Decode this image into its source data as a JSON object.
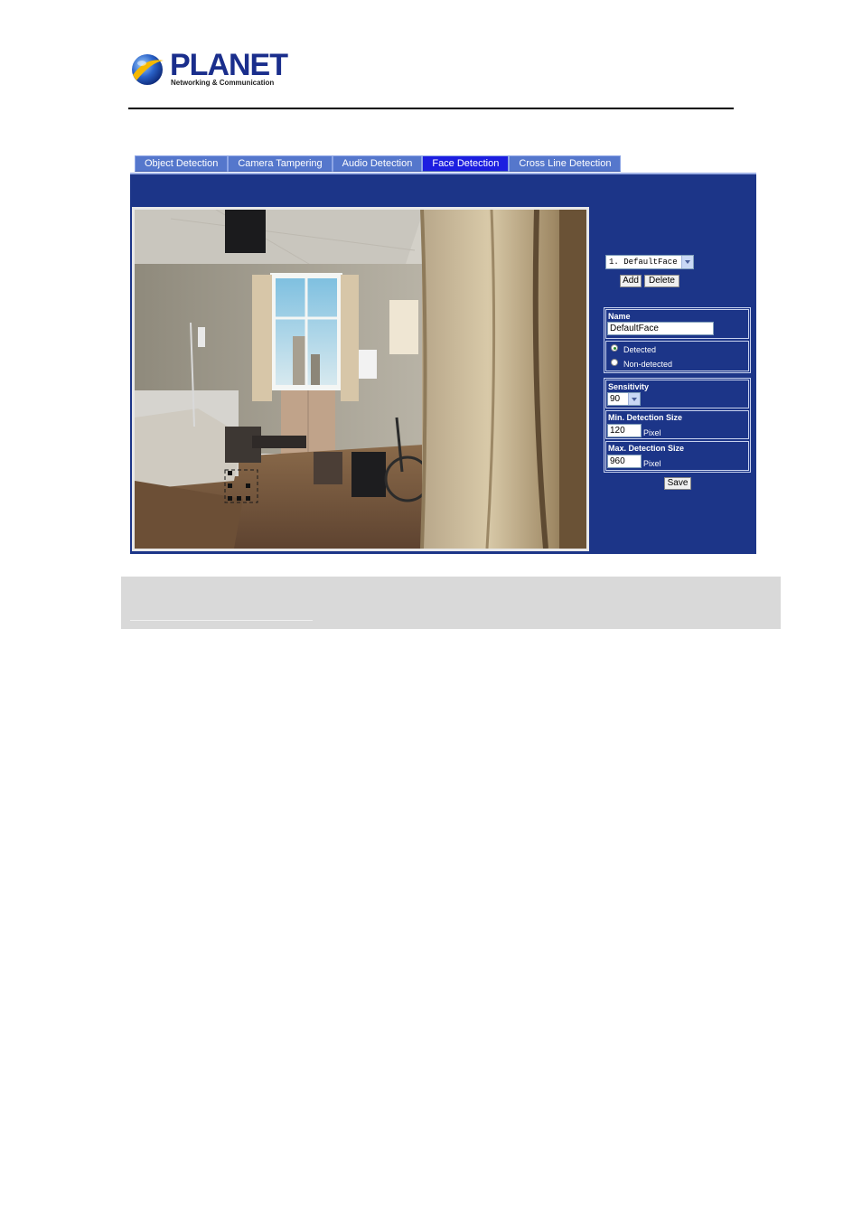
{
  "brand": {
    "name": "PLANET",
    "tagline": "Networking & Communication"
  },
  "tabs": [
    {
      "label": "Object Detection",
      "active": false
    },
    {
      "label": "Camera Tampering",
      "active": false
    },
    {
      "label": "Audio Detection",
      "active": false
    },
    {
      "label": "Face Detection",
      "active": true
    },
    {
      "label": "Cross Line Detection",
      "active": false
    }
  ],
  "profile": {
    "selected": "1. DefaultFace",
    "add_label": "Add",
    "delete_label": "Delete"
  },
  "settings": {
    "name_label": "Name",
    "name_value": "DefaultFace",
    "detected_label": "Detected",
    "non_detected_label": "Non-detected",
    "mode": "Detected",
    "sensitivity_label": "Sensitivity",
    "sensitivity_value": "90",
    "min_size_label": "Min. Detection Size",
    "min_size_value": "120",
    "max_size_label": "Max. Detection Size",
    "max_size_value": "960",
    "unit": "Pixel",
    "save_label": "Save"
  },
  "colors": {
    "panel": "#1c3588",
    "tab": "#5577cc",
    "tab_active": "#1c1ee0"
  }
}
